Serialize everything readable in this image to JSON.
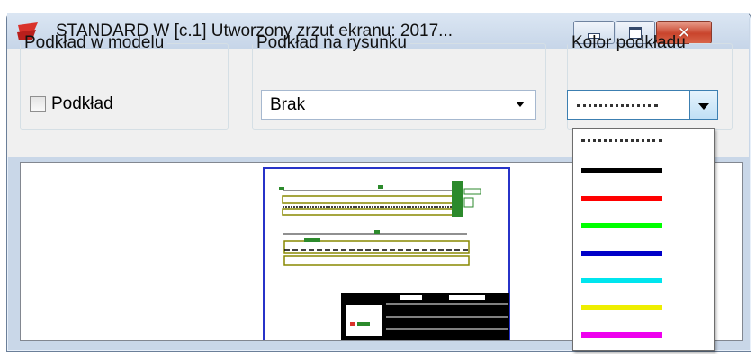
{
  "window": {
    "title": "STANDARD W   [c.1]  Utworzony zrzut ekranu: 2017...",
    "minimize_icon": "minimize-icon",
    "maximize_icon": "maximize-icon",
    "close_glyph": "✕",
    "accent": "#c9442c"
  },
  "groups": {
    "model_background": {
      "legend": "Podkład w modelu",
      "checkbox_label": "Podkład",
      "checked": false
    },
    "drawing_background": {
      "legend": "Podkład na rysunku",
      "selected": "Brak"
    },
    "background_color": {
      "legend": "Kolor podkładu",
      "selected": "dotted"
    }
  },
  "color_options": [
    {
      "name": "dotted",
      "color": "#333333"
    },
    {
      "name": "black",
      "color": "#000000"
    },
    {
      "name": "red",
      "color": "#ff0000"
    },
    {
      "name": "green",
      "color": "#00ff00"
    },
    {
      "name": "blue",
      "color": "#0000c8"
    },
    {
      "name": "cyan",
      "color": "#00e5ee"
    },
    {
      "name": "yellow",
      "color": "#eeee00"
    },
    {
      "name": "magenta",
      "color": "#ee00ee"
    }
  ]
}
